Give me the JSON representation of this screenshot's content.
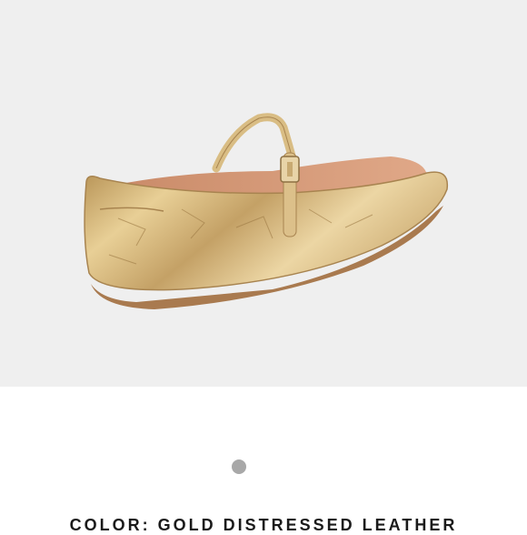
{
  "product": {
    "image_alt": "Gold distressed leather Mary Jane ballet flat",
    "color_line": "COLOR: GOLD DISTRESSED LEATHER"
  },
  "carousel": {
    "dot_count": 1,
    "active_index": 0
  },
  "colors": {
    "image_background": "#efefef",
    "shoe_gold": "#cfae74",
    "dot": "#a8a8a8",
    "text": "#1a1a1a"
  }
}
